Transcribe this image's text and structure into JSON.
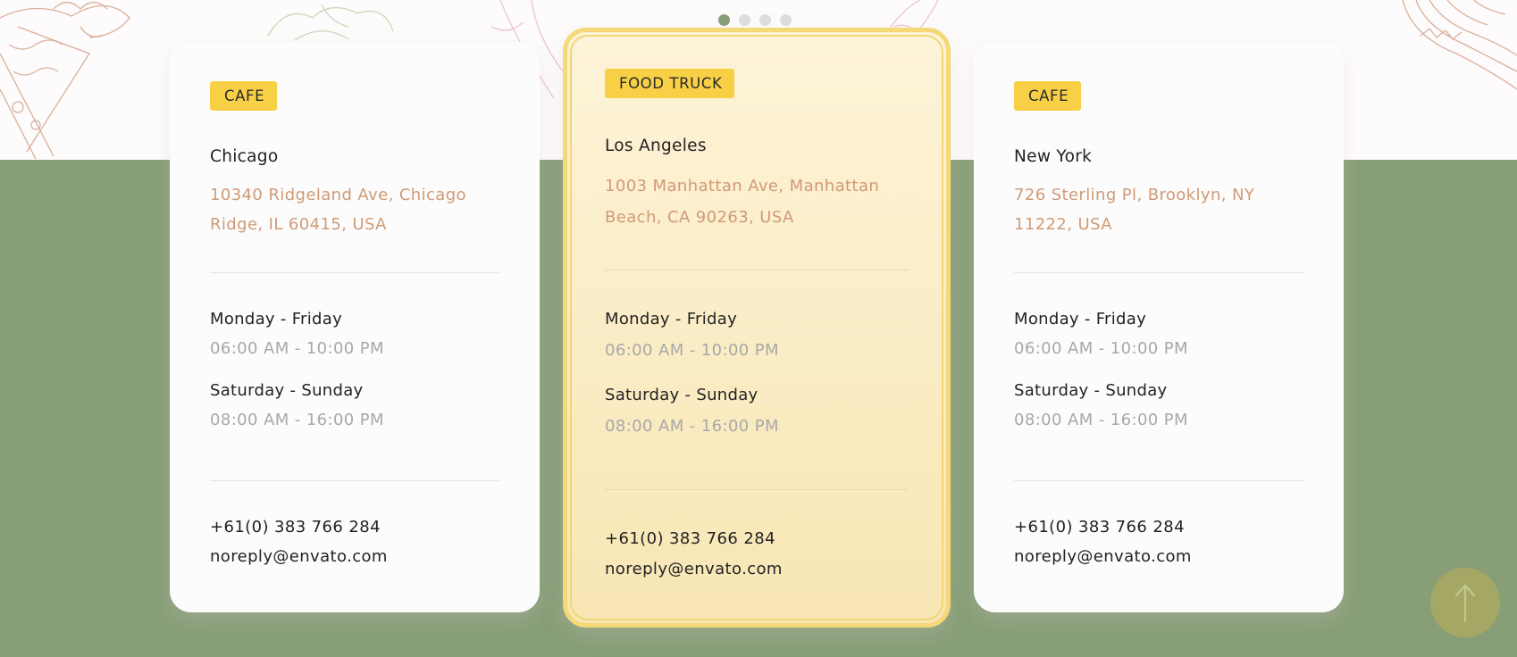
{
  "carousel": {
    "dots": 4,
    "active_index": 0
  },
  "locations": [
    {
      "type_label": "CAFE",
      "city": "Chicago",
      "address_line1": "10340 Ridgeland Ave, Chicago",
      "address_line2": "Ridge, IL 60415, USA",
      "weekday_label": "Monday - Friday",
      "weekday_hours": "06:00 AM - 10:00 PM",
      "weekend_label": "Saturday - Sunday",
      "weekend_hours": "08:00 AM - 16:00 PM",
      "phone": "+61(0) 383 766 284",
      "email": "noreply@envato.com"
    },
    {
      "type_label": "FOOD TRUCK",
      "city": "Los Angeles",
      "address_line1": "1003 Manhattan Ave, Manhattan",
      "address_line2": "Beach, CA 90263, USA",
      "weekday_label": "Monday - Friday",
      "weekday_hours": "06:00 AM - 10:00 PM",
      "weekend_label": "Saturday - Sunday",
      "weekend_hours": "08:00 AM - 16:00 PM",
      "phone": "+61(0) 383 766 284",
      "email": "noreply@envato.com"
    },
    {
      "type_label": "CAFE",
      "city": "New York",
      "address_line1": "726 Sterling Pl, Brooklyn, NY",
      "address_line2": "11222, USA",
      "weekday_label": "Monday - Friday",
      "weekday_hours": "06:00 AM - 10:00 PM",
      "weekend_label": "Saturday - Sunday",
      "weekend_hours": "08:00 AM - 16:00 PM",
      "phone": "+61(0) 383 766 284",
      "email": "noreply@envato.com"
    }
  ],
  "scroll_top": {
    "icon": "arrow-up-icon"
  },
  "colors": {
    "green_band": "#879e77",
    "tag_yellow": "#f7d046",
    "address_accent": "#d09a76",
    "featured_border": "#f5d878",
    "scroll_button": "#a5a865"
  }
}
